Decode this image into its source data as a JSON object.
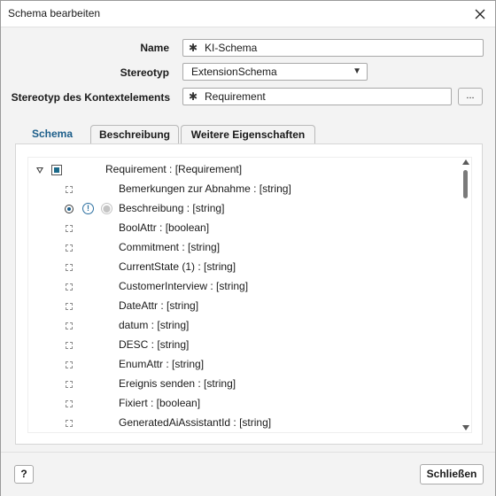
{
  "window": {
    "title": "Schema bearbeiten"
  },
  "form": {
    "name_label": "Name",
    "name_value": "KI-Schema",
    "stereotype_label": "Stereotyp",
    "stereotype_value": "ExtensionSchema",
    "context_label": "Stereotyp des Kontextelements",
    "context_value": "Requirement",
    "more_button": "...",
    "required_marker": "✱"
  },
  "tabs": [
    "Schema",
    "Beschreibung",
    "Weitere Eigenschaften"
  ],
  "tree": {
    "root": "Requirement : [Requirement]",
    "items": [
      "Bemerkungen zur Abnahme : [string]",
      "Beschreibung : [string]",
      "BoolAttr : [boolean]",
      "Commitment : [string]",
      "CurrentState (1) : [string]",
      "CustomerInterview : [string]",
      "DateAttr : [string]",
      "datum : [string]",
      "DESC : [string]",
      "EnumAttr : [string]",
      "Ereignis senden : [string]",
      "Fixiert : [boolean]",
      "GeneratedAiAssistantId : [string]"
    ]
  },
  "footer": {
    "help": "?",
    "close": "Schließen"
  },
  "colors": {
    "accent": "#1b6a8a",
    "active_tab": "#1c5e8a"
  },
  "icons": [
    "close-icon",
    "dropdown-arrow-icon",
    "expand-triangle-icon",
    "info-icon",
    "lock-icon"
  ]
}
